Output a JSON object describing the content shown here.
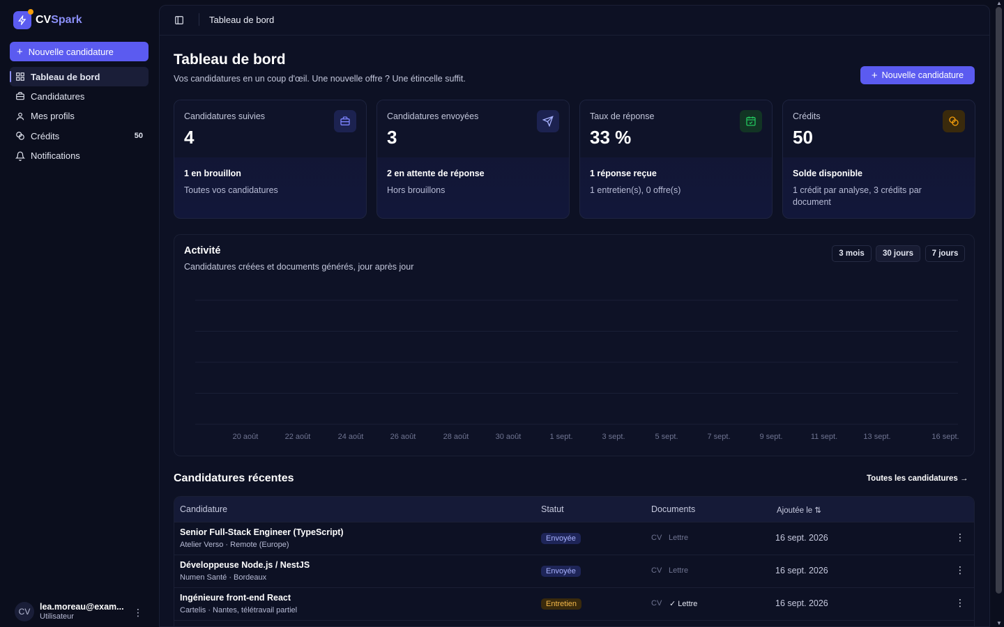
{
  "brand": {
    "name_a": "CV",
    "name_b": "Spark"
  },
  "sidebar": {
    "new_label": "Nouvelle candidature",
    "items": [
      {
        "label": "Tableau de bord",
        "icon": "layout-grid-icon",
        "active": true
      },
      {
        "label": "Candidatures",
        "icon": "briefcase-icon"
      },
      {
        "label": "Mes profils",
        "icon": "user-icon"
      },
      {
        "label": "Crédits",
        "icon": "coins-icon",
        "count": "50"
      },
      {
        "label": "Notifications",
        "icon": "bell-icon"
      }
    ],
    "user": {
      "initials": "CV",
      "email": "lea.moreau@exam...",
      "role": "Utilisateur"
    }
  },
  "topbar": {
    "breadcrumb": "Tableau de bord"
  },
  "header": {
    "title": "Tableau de bord",
    "subtitle": "Vos candidatures en un coup d'œil. Une nouvelle offre ? Une étincelle suffit.",
    "new_label": "Nouvelle candidature"
  },
  "cards": [
    {
      "label": "Candidatures suivies",
      "value": "4",
      "headline": "1 en brouillon",
      "note": "Toutes vos candidatures",
      "icon": "briefcase-icon",
      "accent": "#7c83ff"
    },
    {
      "label": "Candidatures envoyées",
      "value": "3",
      "headline": "2 en attente de réponse",
      "note": "Hors brouillons",
      "icon": "send-icon",
      "accent": "#7c83ff"
    },
    {
      "label": "Taux de réponse",
      "value": "33 %",
      "headline": "1 réponse reçue",
      "note": "1 entretien(s), 0 offre(s)",
      "icon": "calendar-check-icon",
      "accent": "#22c55e"
    },
    {
      "label": "Crédits",
      "value": "50",
      "headline": "Solde disponible",
      "note": "1 crédit par analyse, 3 crédits par document",
      "icon": "coins-icon",
      "accent": "#f59e0b"
    }
  ],
  "activity": {
    "title": "Activité",
    "subtitle": "Candidatures créées et documents générés, jour après jour",
    "ranges": [
      "3 mois",
      "30 jours",
      "7 jours"
    ],
    "active_range": "30 jours"
  },
  "chart_data": {
    "type": "area",
    "title": "Activité",
    "categories": [
      "20 août",
      "22 août",
      "24 août",
      "26 août",
      "28 août",
      "30 août",
      "1 sept.",
      "3 sept.",
      "5 sept.",
      "7 sept.",
      "9 sept.",
      "11 sept.",
      "13 sept.",
      "16 sept."
    ],
    "values": [
      0,
      0,
      0,
      0,
      0,
      0,
      0,
      0,
      0,
      0,
      0,
      0,
      0,
      0
    ],
    "grid": true
  },
  "recent": {
    "title": "Candidatures récentes",
    "link": "Toutes les candidatures →",
    "columns": [
      "Candidature",
      "Statut",
      "Documents",
      "Ajoutée le ⇅"
    ],
    "rows": [
      {
        "title": "Senior Full-Stack Engineer (TypeScript)",
        "sub": "Atelier Verso · Remote (Europe)",
        "status": "Envoyée",
        "status_kind": "sent",
        "cv": "CV",
        "letter": "Lettre",
        "letter_ok": false,
        "date": "16 sept. 2026"
      },
      {
        "title": "Développeuse Node.js / NestJS",
        "sub": "Numen Santé · Bordeaux",
        "status": "Envoyée",
        "status_kind": "sent",
        "cv": "CV",
        "letter": "Lettre",
        "letter_ok": false,
        "date": "16 sept. 2026"
      },
      {
        "title": "Ingénieure front-end React",
        "sub": "Cartelis · Nantes, télétravail partiel",
        "status": "Entretien",
        "status_kind": "interview",
        "cv": "CV",
        "letter": "✓ Lettre",
        "letter_ok": true,
        "date": "16 sept. 2026"
      }
    ]
  }
}
